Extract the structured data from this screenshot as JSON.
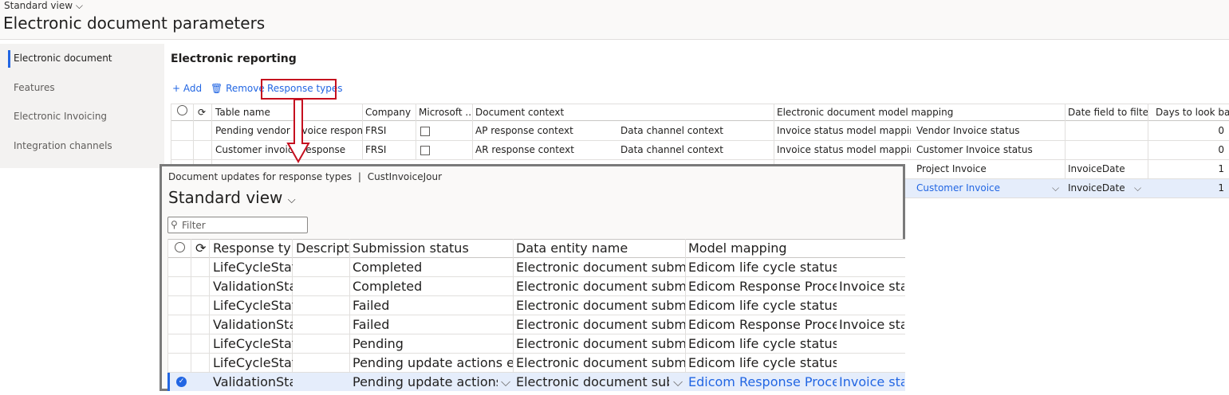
{
  "page": {
    "view_selector": "Standard view",
    "title": "Electronic document parameters"
  },
  "nav": {
    "items": [
      "Electronic document",
      "Features",
      "Electronic Invoicing",
      "Integration channels"
    ]
  },
  "section": {
    "title": "Electronic reporting"
  },
  "toolbar": {
    "add": "Add",
    "remove": "Remove",
    "response_types": "Response types"
  },
  "main_grid": {
    "headers": {
      "table_name": "Table name",
      "company": "Company",
      "microsoft": "Microsoft ...",
      "doc_context": "Document context",
      "model_mapping": "Electronic document model mapping",
      "date_field": "Date field to filter",
      "days_back": "Days to look back"
    },
    "rows": [
      {
        "table_name": "Pending vendor invoice response",
        "company": "FRSI",
        "doc_context": "AP response context",
        "context2": "Data channel context",
        "mapping": "Invoice status model mapping",
        "mapping2": "Vendor Invoice status",
        "date_field": "",
        "days": "0"
      },
      {
        "table_name": "Customer invoice response",
        "company": "FRSI",
        "doc_context": "AR response context",
        "context2": "Data channel context",
        "mapping": "Invoice status model mapping",
        "mapping2": "Customer Invoice status",
        "date_field": "",
        "days": "0"
      },
      {
        "mapping2": "Project Invoice",
        "date_field": "InvoiceDate",
        "days": "1"
      },
      {
        "mapping2": "Customer Invoice",
        "date_field": "InvoiceDate",
        "days": "1"
      }
    ]
  },
  "dialog": {
    "crumb_left": "Document updates for response types",
    "crumb_sep": "|",
    "crumb_right": "CustInvoiceJour",
    "view_title": "Standard view",
    "filter_placeholder": "Filter",
    "headers": {
      "response_type": "Response type",
      "description": "Description",
      "submission_status": "Submission status",
      "data_entity": "Data entity name",
      "model_mapping": "Model mapping"
    },
    "rows": [
      {
        "type": "LifeCycleStatus",
        "status": "Completed",
        "entity": "Electronic document submission log",
        "mapping": "Edicom life cycle status format (FR)",
        "mapping2": ""
      },
      {
        "type": "ValidationStatus",
        "status": "Completed",
        "entity": "Electronic document submission log",
        "mapping": "Edicom Response Processing (FR)",
        "mapping2": "Invoice status"
      },
      {
        "type": "LifeCycleStatus",
        "status": "Failed",
        "entity": "Electronic document submission log",
        "mapping": "Edicom life cycle status format (FR)",
        "mapping2": ""
      },
      {
        "type": "ValidationStatus",
        "status": "Failed",
        "entity": "Electronic document submission log",
        "mapping": "Edicom Response Processing (FR)",
        "mapping2": "Invoice status"
      },
      {
        "type": "LifeCycleStatus",
        "status": "Pending",
        "entity": "Electronic document submission log",
        "mapping": "Edicom life cycle status format (FR)",
        "mapping2": ""
      },
      {
        "type": "LifeCycleStatus",
        "status": "Pending update actions execution",
        "entity": "Electronic document submission log",
        "mapping": "Edicom life cycle status format (FR)",
        "mapping2": ""
      },
      {
        "type": "ValidationStatus",
        "status": "Pending update actions execution",
        "entity": "Electronic document submission l...",
        "mapping": "Edicom Response Processing (FR)",
        "mapping2": "Invoice status"
      }
    ]
  },
  "colors": {
    "accent": "#2266e3",
    "highlight_box": "#c50f1f",
    "selected_row": "#e5edfb"
  }
}
